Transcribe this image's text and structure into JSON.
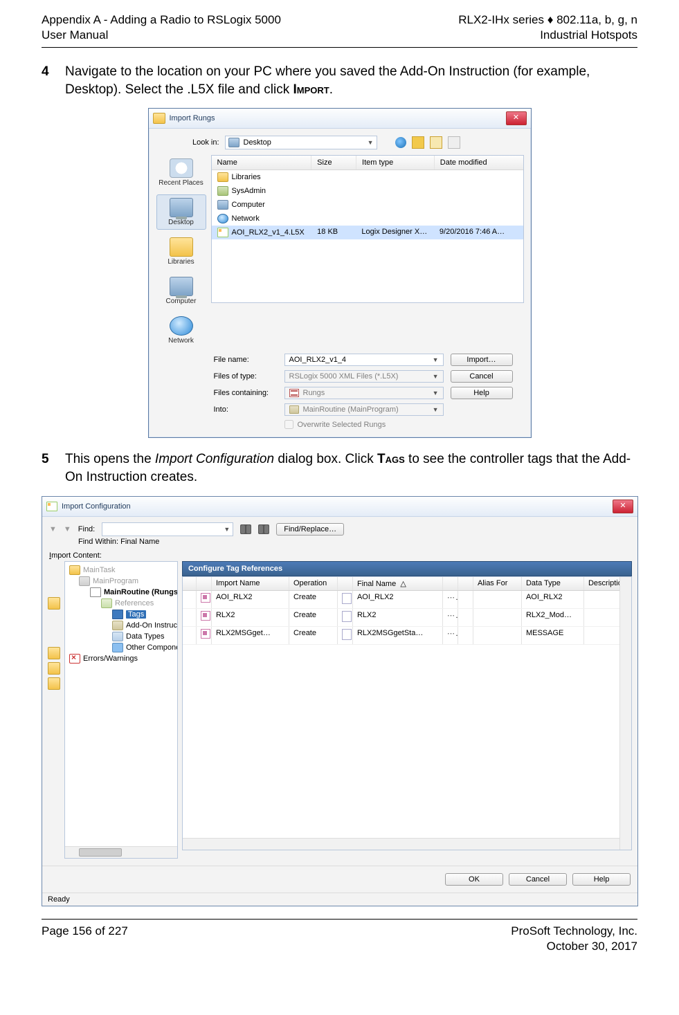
{
  "header": {
    "left_line1": "Appendix A - Adding a Radio to RSLogix 5000",
    "left_line2": "User Manual",
    "right_line1": "RLX2-IHx series ♦ 802.11a, b, g, n",
    "right_line2": "Industrial Hotspots"
  },
  "steps": {
    "s4_num": "4",
    "s4_text_a": "Navigate to the location on your PC where you saved the Add-On Instruction (for example, Desktop). Select the .L5X file and click ",
    "s4_text_b": "Import",
    "s4_text_c": ".",
    "s5_num": "5",
    "s5_text_a": "This opens the ",
    "s5_text_b": "Import Configuration",
    "s5_text_c": " dialog box. Click ",
    "s5_text_d": "Tags",
    "s5_text_e": " to see the controller tags that the Add-On Instruction creates."
  },
  "dlg1": {
    "title": "Import Rungs",
    "lookin_label": "Look in:",
    "lookin_value": "Desktop",
    "cols": {
      "name": "Name",
      "size": "Size",
      "type": "Item type",
      "date": "Date modified"
    },
    "rows": [
      {
        "icon": "mini-folder",
        "name": "Libraries",
        "size": "",
        "type": "",
        "date": ""
      },
      {
        "icon": "mini-sys",
        "name": "SysAdmin",
        "size": "",
        "type": "",
        "date": ""
      },
      {
        "icon": "mini-pc",
        "name": "Computer",
        "size": "",
        "type": "",
        "date": ""
      },
      {
        "icon": "mini-net",
        "name": "Network",
        "size": "",
        "type": "",
        "date": ""
      },
      {
        "icon": "mini-file",
        "name": "AOI_RLX2_v1_4.L5X",
        "size": "18 KB",
        "type": "Logix Designer X…",
        "date": "9/20/2016 7:46 A…",
        "sel": true
      }
    ],
    "places": {
      "recent": "Recent Places",
      "desktop": "Desktop",
      "libraries": "Libraries",
      "computer": "Computer",
      "network": "Network"
    },
    "bottom": {
      "filename_label": "File name:",
      "filename_value": "AOI_RLX2_v1_4",
      "filetype_label": "Files of type:",
      "filetype_value": "RSLogix 5000 XML Files (*.L5X)",
      "filescont_label": "Files containing:",
      "filescont_value": "Rungs",
      "into_label": "Into:",
      "into_value": "MainRoutine (MainProgram)",
      "overwrite": "Overwrite Selected Rungs",
      "btn_import": "Import…",
      "btn_cancel": "Cancel",
      "btn_help": "Help"
    }
  },
  "dlg2": {
    "title": "Import Configuration",
    "find_label": "Find:",
    "find_replace": "Find/Replace…",
    "find_within": "Find Within: Final Name",
    "import_content_label": "Import Content:",
    "tree": {
      "maintask": "MainTask",
      "mainprogram": "MainProgram",
      "mainroutine": "MainRoutine (Rungs)",
      "references": "References",
      "tags": "Tags",
      "aoi": "Add-On Instructions",
      "datatypes": "Data Types",
      "other": "Other Components",
      "errors": "Errors/Warnings"
    },
    "config_header": "Configure Tag References",
    "gridcols": {
      "import_name": "Import Name",
      "operation": "Operation",
      "final_name": "Final Name",
      "alias": "Alias For",
      "dtype": "Data Type",
      "desc": "Description"
    },
    "gridrows": [
      {
        "name": "AOI_RLX2",
        "op": "Create",
        "final": "AOI_RLX2",
        "dtype": "AOI_RLX2"
      },
      {
        "name": "RLX2",
        "op": "Create",
        "final": "RLX2",
        "dtype": "RLX2_Mod…"
      },
      {
        "name": "RLX2MSGget…",
        "op": "Create",
        "final": "RLX2MSGgetSta…",
        "dtype": "MESSAGE"
      }
    ],
    "btn_ok": "OK",
    "btn_cancel": "Cancel",
    "btn_help": "Help",
    "status": "Ready"
  },
  "footer": {
    "left": "Page 156 of 227",
    "right_line1": "ProSoft Technology, Inc.",
    "right_line2": "October 30, 2017"
  }
}
